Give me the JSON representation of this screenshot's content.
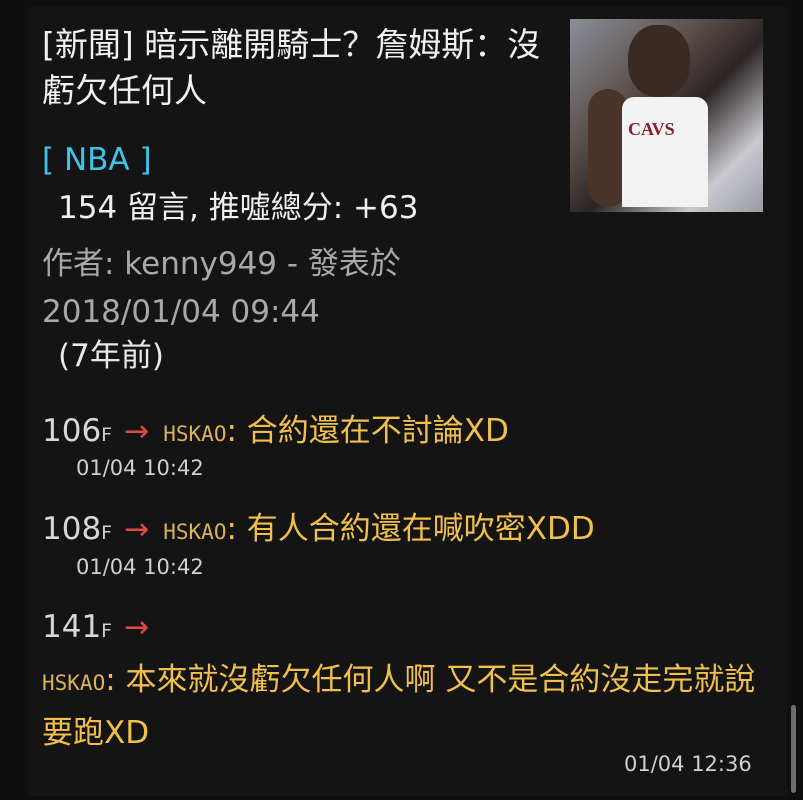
{
  "post": {
    "title": "[新聞] 暗示離開騎士？詹姆斯：沒虧欠任何人",
    "board": "[ NBA ]",
    "stats": "154 留言, 推噓總分: +63",
    "meta": "作者: kenny949 - 發表於 2018/01/04 09:44",
    "ago": "(7年前)",
    "thumbnail_text": "CAVS"
  },
  "comments": [
    {
      "floor": "106",
      "floor_suffix": "F",
      "arrow": "→",
      "user": "HSKAO",
      "text": ": 合約還在不討論XD",
      "time": "01/04 10:42"
    },
    {
      "floor": "108",
      "floor_suffix": "F",
      "arrow": "→",
      "user": "HSKAO",
      "text": ": 有人合約還在喊吹密XDD",
      "time": "01/04 10:42"
    },
    {
      "floor": "141",
      "floor_suffix": "F",
      "arrow": "→",
      "user": "HSKAO",
      "text": ": 本來就沒虧欠任何人啊 又不是合約沒走完就說要跑XD",
      "time": "01/04 12:36"
    }
  ]
}
